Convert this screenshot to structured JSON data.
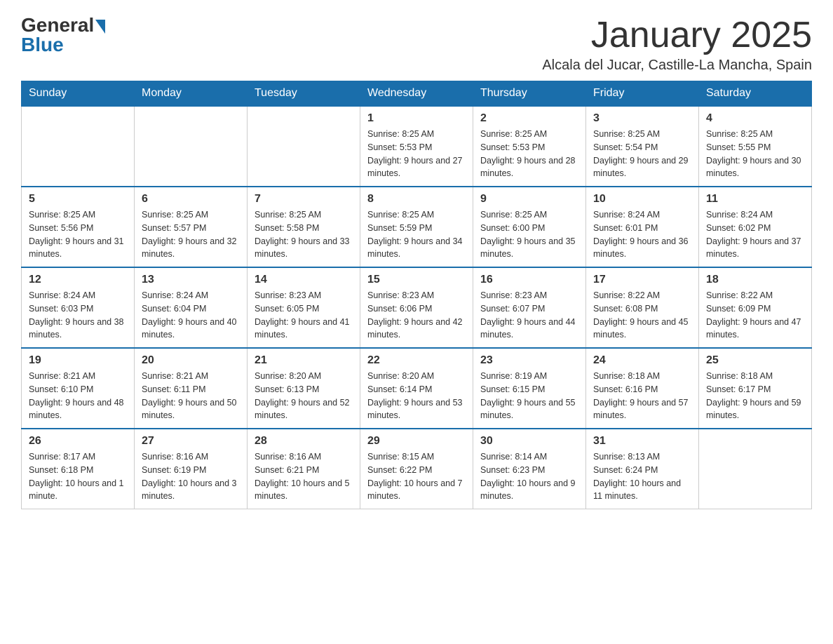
{
  "logo": {
    "general": "General",
    "blue": "Blue"
  },
  "header": {
    "month": "January 2025",
    "location": "Alcala del Jucar, Castille-La Mancha, Spain"
  },
  "weekdays": [
    "Sunday",
    "Monday",
    "Tuesday",
    "Wednesday",
    "Thursday",
    "Friday",
    "Saturday"
  ],
  "weeks": [
    [
      {
        "day": "",
        "info": ""
      },
      {
        "day": "",
        "info": ""
      },
      {
        "day": "",
        "info": ""
      },
      {
        "day": "1",
        "info": "Sunrise: 8:25 AM\nSunset: 5:53 PM\nDaylight: 9 hours and 27 minutes."
      },
      {
        "day": "2",
        "info": "Sunrise: 8:25 AM\nSunset: 5:53 PM\nDaylight: 9 hours and 28 minutes."
      },
      {
        "day": "3",
        "info": "Sunrise: 8:25 AM\nSunset: 5:54 PM\nDaylight: 9 hours and 29 minutes."
      },
      {
        "day": "4",
        "info": "Sunrise: 8:25 AM\nSunset: 5:55 PM\nDaylight: 9 hours and 30 minutes."
      }
    ],
    [
      {
        "day": "5",
        "info": "Sunrise: 8:25 AM\nSunset: 5:56 PM\nDaylight: 9 hours and 31 minutes."
      },
      {
        "day": "6",
        "info": "Sunrise: 8:25 AM\nSunset: 5:57 PM\nDaylight: 9 hours and 32 minutes."
      },
      {
        "day": "7",
        "info": "Sunrise: 8:25 AM\nSunset: 5:58 PM\nDaylight: 9 hours and 33 minutes."
      },
      {
        "day": "8",
        "info": "Sunrise: 8:25 AM\nSunset: 5:59 PM\nDaylight: 9 hours and 34 minutes."
      },
      {
        "day": "9",
        "info": "Sunrise: 8:25 AM\nSunset: 6:00 PM\nDaylight: 9 hours and 35 minutes."
      },
      {
        "day": "10",
        "info": "Sunrise: 8:24 AM\nSunset: 6:01 PM\nDaylight: 9 hours and 36 minutes."
      },
      {
        "day": "11",
        "info": "Sunrise: 8:24 AM\nSunset: 6:02 PM\nDaylight: 9 hours and 37 minutes."
      }
    ],
    [
      {
        "day": "12",
        "info": "Sunrise: 8:24 AM\nSunset: 6:03 PM\nDaylight: 9 hours and 38 minutes."
      },
      {
        "day": "13",
        "info": "Sunrise: 8:24 AM\nSunset: 6:04 PM\nDaylight: 9 hours and 40 minutes."
      },
      {
        "day": "14",
        "info": "Sunrise: 8:23 AM\nSunset: 6:05 PM\nDaylight: 9 hours and 41 minutes."
      },
      {
        "day": "15",
        "info": "Sunrise: 8:23 AM\nSunset: 6:06 PM\nDaylight: 9 hours and 42 minutes."
      },
      {
        "day": "16",
        "info": "Sunrise: 8:23 AM\nSunset: 6:07 PM\nDaylight: 9 hours and 44 minutes."
      },
      {
        "day": "17",
        "info": "Sunrise: 8:22 AM\nSunset: 6:08 PM\nDaylight: 9 hours and 45 minutes."
      },
      {
        "day": "18",
        "info": "Sunrise: 8:22 AM\nSunset: 6:09 PM\nDaylight: 9 hours and 47 minutes."
      }
    ],
    [
      {
        "day": "19",
        "info": "Sunrise: 8:21 AM\nSunset: 6:10 PM\nDaylight: 9 hours and 48 minutes."
      },
      {
        "day": "20",
        "info": "Sunrise: 8:21 AM\nSunset: 6:11 PM\nDaylight: 9 hours and 50 minutes."
      },
      {
        "day": "21",
        "info": "Sunrise: 8:20 AM\nSunset: 6:13 PM\nDaylight: 9 hours and 52 minutes."
      },
      {
        "day": "22",
        "info": "Sunrise: 8:20 AM\nSunset: 6:14 PM\nDaylight: 9 hours and 53 minutes."
      },
      {
        "day": "23",
        "info": "Sunrise: 8:19 AM\nSunset: 6:15 PM\nDaylight: 9 hours and 55 minutes."
      },
      {
        "day": "24",
        "info": "Sunrise: 8:18 AM\nSunset: 6:16 PM\nDaylight: 9 hours and 57 minutes."
      },
      {
        "day": "25",
        "info": "Sunrise: 8:18 AM\nSunset: 6:17 PM\nDaylight: 9 hours and 59 minutes."
      }
    ],
    [
      {
        "day": "26",
        "info": "Sunrise: 8:17 AM\nSunset: 6:18 PM\nDaylight: 10 hours and 1 minute."
      },
      {
        "day": "27",
        "info": "Sunrise: 8:16 AM\nSunset: 6:19 PM\nDaylight: 10 hours and 3 minutes."
      },
      {
        "day": "28",
        "info": "Sunrise: 8:16 AM\nSunset: 6:21 PM\nDaylight: 10 hours and 5 minutes."
      },
      {
        "day": "29",
        "info": "Sunrise: 8:15 AM\nSunset: 6:22 PM\nDaylight: 10 hours and 7 minutes."
      },
      {
        "day": "30",
        "info": "Sunrise: 8:14 AM\nSunset: 6:23 PM\nDaylight: 10 hours and 9 minutes."
      },
      {
        "day": "31",
        "info": "Sunrise: 8:13 AM\nSunset: 6:24 PM\nDaylight: 10 hours and 11 minutes."
      },
      {
        "day": "",
        "info": ""
      }
    ]
  ]
}
